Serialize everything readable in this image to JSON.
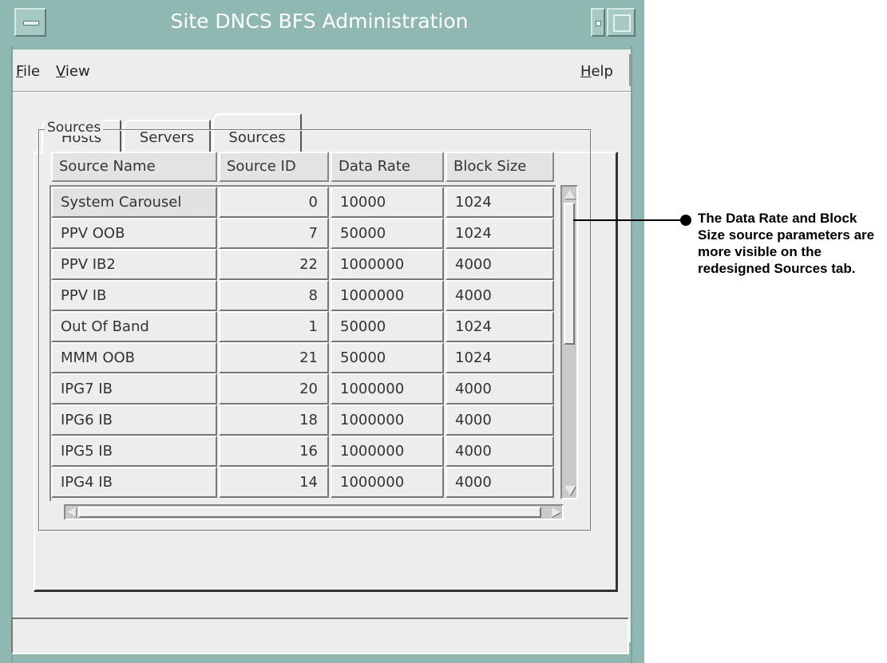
{
  "window": {
    "title": "Site DNCS BFS Administration"
  },
  "menubar": {
    "file_prefix": "F",
    "file_rest": "ile",
    "view_prefix": "V",
    "view_rest": "iew",
    "help_prefix": "H",
    "help_rest": "elp"
  },
  "tabs": [
    {
      "label": "Hosts",
      "selected": false
    },
    {
      "label": "Servers",
      "selected": false
    },
    {
      "label": "Sources",
      "selected": true
    }
  ],
  "group": {
    "label": "Sources"
  },
  "table": {
    "columns": [
      "Source Name",
      "Source ID",
      "Data Rate",
      "Block Size"
    ],
    "rows": [
      [
        "System Carousel",
        "0",
        "10000",
        "1024"
      ],
      [
        "PPV OOB",
        "7",
        "50000",
        "1024"
      ],
      [
        "PPV IB2",
        "22",
        "1000000",
        "4000"
      ],
      [
        "PPV IB",
        "8",
        "1000000",
        "4000"
      ],
      [
        "Out Of Band",
        "1",
        "50000",
        "1024"
      ],
      [
        "MMM OOB",
        "21",
        "50000",
        "1024"
      ],
      [
        "IPG7 IB",
        "20",
        "1000000",
        "4000"
      ],
      [
        "IPG6 IB",
        "18",
        "1000000",
        "4000"
      ],
      [
        "IPG5 IB",
        "16",
        "1000000",
        "4000"
      ],
      [
        "IPG4 IB",
        "14",
        "1000000",
        "4000"
      ]
    ]
  },
  "status_bar": {
    "text": ""
  },
  "callout": {
    "text": "The Data Rate and Block Size source parameters are more visible on the redesigned Sources tab."
  },
  "colors": {
    "window_frame": "#8fb8b2",
    "client_bg": "#ededed"
  },
  "icons": {
    "window_menu": "window-menu-icon",
    "minimize": "minimize-icon",
    "maximize": "maximize-icon",
    "scroll_up": "scroll-up-arrow-icon",
    "scroll_down": "scroll-down-arrow-icon",
    "scroll_left": "scroll-left-arrow-icon",
    "scroll_right": "scroll-right-arrow-icon"
  }
}
